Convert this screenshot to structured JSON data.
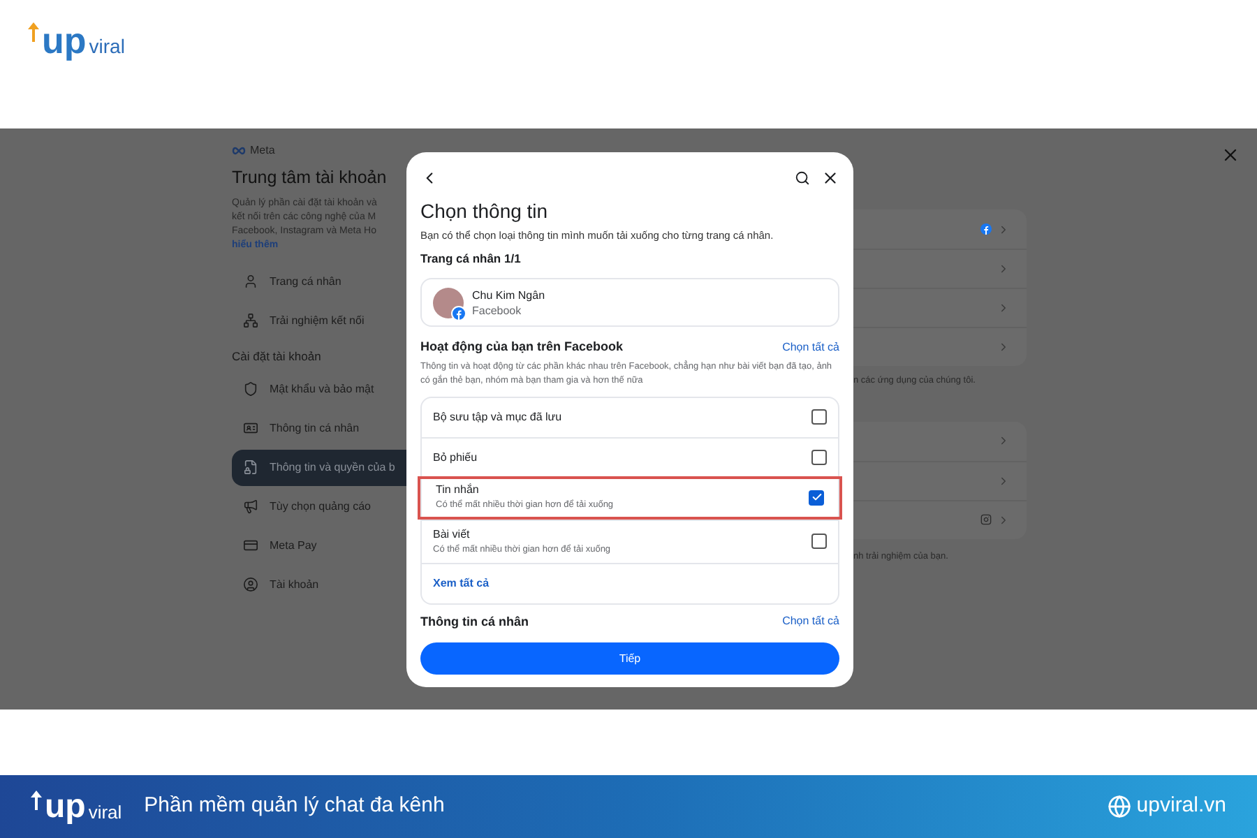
{
  "brand": {
    "logo_mark": "up",
    "logo_text": "viral"
  },
  "sidebar": {
    "brand": "Meta",
    "title": "Trung tâm tài khoản",
    "description_lines": [
      "Quản lý phần cài đặt tài khoản và",
      "kết nối trên các công nghệ của M",
      "Facebook, Instagram và Meta Ho"
    ],
    "learn_more": "hiểu thêm",
    "items": [
      {
        "label": "Trang cá nhân",
        "selected": false
      },
      {
        "label": "Trải nghiệm kết nối",
        "selected": false
      }
    ],
    "section": "Cài đặt tài khoản",
    "settings": [
      {
        "label": "Mật khẩu và bảo mật",
        "selected": false
      },
      {
        "label": "Thông tin cá nhân",
        "selected": false
      },
      {
        "label": "Thông tin và quyền của b",
        "selected": true
      },
      {
        "label": "Tùy chọn quảng cáo",
        "selected": false
      },
      {
        "label": "Meta Pay",
        "selected": false
      },
      {
        "label": "Tài khoản",
        "selected": false
      }
    ]
  },
  "background_notes": [
    "n các ứng dụng của chúng tôi.",
    "nh trải nghiệm của bạn."
  ],
  "dialog": {
    "title": "Chọn thông tin",
    "description": "Bạn có thể chọn loại thông tin mình muốn tải xuống cho từng trang cá nhân.",
    "profile_count": "Trang cá nhân 1/1",
    "profile": {
      "name": "Chu Kim Ngân",
      "platform": "Facebook"
    },
    "section": {
      "title": "Hoạt động của bạn trên Facebook",
      "select_all": "Chọn tất cả",
      "description": "Thông tin và hoạt động từ các phần khác nhau trên Facebook, chẳng hạn như bài viết bạn đã tạo, ảnh có gắn thẻ bạn, nhóm mà bạn tham gia và hơn thế nữa"
    },
    "options": [
      {
        "title": "Bộ sưu tập và mục đã lưu",
        "checked": false,
        "highlighted": false
      },
      {
        "title": "Bỏ phiếu",
        "checked": false,
        "highlighted": false
      },
      {
        "title": "Tin nhắn",
        "subtitle": "Có thể mất nhiều thời gian hơn để tải xuống",
        "checked": true,
        "highlighted": true
      },
      {
        "title": "Bài viết",
        "subtitle": "Có thể mất nhiều thời gian hơn để tải xuống",
        "checked": false,
        "highlighted": false
      }
    ],
    "see_all": "Xem tất cả",
    "next_section": {
      "title": "Thông tin cá nhân",
      "select_all": "Chọn tất cả"
    },
    "button": "Tiếp"
  },
  "footer": {
    "logo_mark": "up",
    "logo_text": "viral",
    "tagline": "Phần mềm quản lý chat đa kênh",
    "website": "upviral.vn"
  }
}
